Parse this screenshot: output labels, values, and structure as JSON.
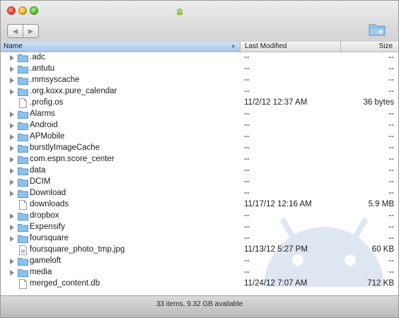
{
  "window": {
    "title": ""
  },
  "toolbar": {
    "back_label": "◀",
    "forward_label": "▶"
  },
  "columns": {
    "name": "Name",
    "modified": "Last Modified",
    "size": "Size"
  },
  "rows": [
    {
      "name": ".adc",
      "type": "folder",
      "modified": "--",
      "size": "--"
    },
    {
      "name": ".antutu",
      "type": "folder",
      "modified": "--",
      "size": "--"
    },
    {
      "name": ".mmsyscache",
      "type": "folder",
      "modified": "--",
      "size": "--"
    },
    {
      "name": ".org.koxx.pure_calendar",
      "type": "folder",
      "modified": "--",
      "size": "--"
    },
    {
      "name": ".profig.os",
      "type": "file",
      "modified": "11/2/12 12:37 AM",
      "size": "36 bytes"
    },
    {
      "name": "Alarms",
      "type": "folder",
      "modified": "--",
      "size": "--"
    },
    {
      "name": "Android",
      "type": "folder",
      "modified": "--",
      "size": "--"
    },
    {
      "name": "APMobile",
      "type": "folder",
      "modified": "--",
      "size": "--"
    },
    {
      "name": "burstlyImageCache",
      "type": "folder",
      "modified": "--",
      "size": "--"
    },
    {
      "name": "com.espn.score_center",
      "type": "folder",
      "modified": "--",
      "size": "--"
    },
    {
      "name": "data",
      "type": "folder",
      "modified": "--",
      "size": "--"
    },
    {
      "name": "DCIM",
      "type": "folder",
      "modified": "--",
      "size": "--"
    },
    {
      "name": "Download",
      "type": "folder",
      "modified": "--",
      "size": "--"
    },
    {
      "name": "downloads",
      "type": "file",
      "modified": "11/17/12 12:16 AM",
      "size": "5.9 MB"
    },
    {
      "name": "dropbox",
      "type": "folder",
      "modified": "--",
      "size": "--"
    },
    {
      "name": "Expensify",
      "type": "folder",
      "modified": "--",
      "size": "--"
    },
    {
      "name": "foursquare",
      "type": "folder",
      "modified": "--",
      "size": "--"
    },
    {
      "name": "foursquare_photo_tmp.jpg",
      "type": "image",
      "modified": "11/13/12 5:27 PM",
      "size": "60 KB"
    },
    {
      "name": "gameloft",
      "type": "folder",
      "modified": "--",
      "size": "--"
    },
    {
      "name": "media",
      "type": "folder",
      "modified": "--",
      "size": "--"
    },
    {
      "name": "merged_content.db",
      "type": "file",
      "modified": "11/24/12 7:07 AM",
      "size": "712 KB"
    }
  ],
  "status": {
    "text": "33 items, 9.32 GB available"
  },
  "colors": {
    "folder": "#8ec1ea",
    "header_selected": "#a9c7ea",
    "watermark": "#9bb3d6"
  },
  "icons": {
    "folder": "folder-icon",
    "file": "document-icon",
    "image": "image-file-icon",
    "disclosure": "disclosure-triangle-icon",
    "new_folder": "new-folder-icon",
    "app": "android-robot-icon"
  }
}
